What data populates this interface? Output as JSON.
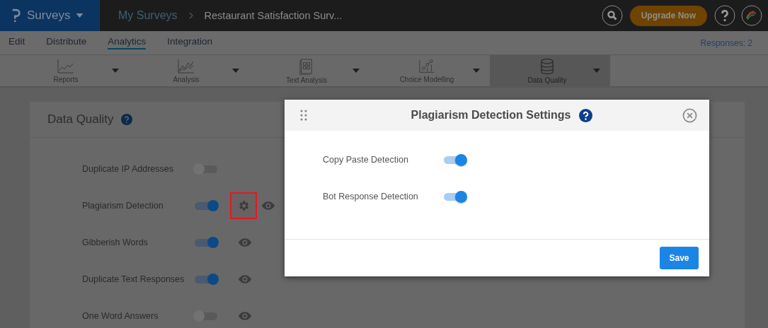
{
  "topbar": {
    "product": "Surveys",
    "breadcrumb": "My Surveys",
    "survey_title": "Restaurant Satisfaction Surv...",
    "upgrade_button": "Upgrade Now"
  },
  "tabs": [
    {
      "label": "Edit",
      "selected": false
    },
    {
      "label": "Distribute",
      "selected": false
    },
    {
      "label": "Analytics",
      "selected": true
    },
    {
      "label": "Integration",
      "selected": false
    }
  ],
  "responses": "Responses: 2",
  "toolbar": [
    {
      "label": "Reports",
      "kind": "reports",
      "selected": false
    },
    {
      "label": "Analysis",
      "kind": "analysis",
      "selected": false
    },
    {
      "label": "Text Analysis",
      "kind": "text",
      "selected": false
    },
    {
      "label": "Choice Modelling",
      "kind": "choice",
      "selected": false
    },
    {
      "label": "Data Quality",
      "kind": "database",
      "selected": true
    }
  ],
  "panel": {
    "title": "Data Quality",
    "rows": [
      {
        "label": "Duplicate IP Addresses",
        "on": false,
        "preview": false
      },
      {
        "label": "Plagiarism Detection",
        "on": true,
        "settings_button": {
          "highlighted": true
        },
        "preview": true
      },
      {
        "label": "Gibberish Words",
        "on": true,
        "preview": true
      },
      {
        "label": "Duplicate Text Responses",
        "on": true,
        "preview": true
      },
      {
        "label": "One Word Answers",
        "on": false,
        "preview": true
      }
    ]
  },
  "dialog": {
    "title": "Plagiarism Detection Settings",
    "options": [
      {
        "label": "Copy Paste Detection",
        "on": true
      },
      {
        "label": "Bot Response Detection",
        "on": true
      }
    ],
    "save_button": "Save"
  }
}
